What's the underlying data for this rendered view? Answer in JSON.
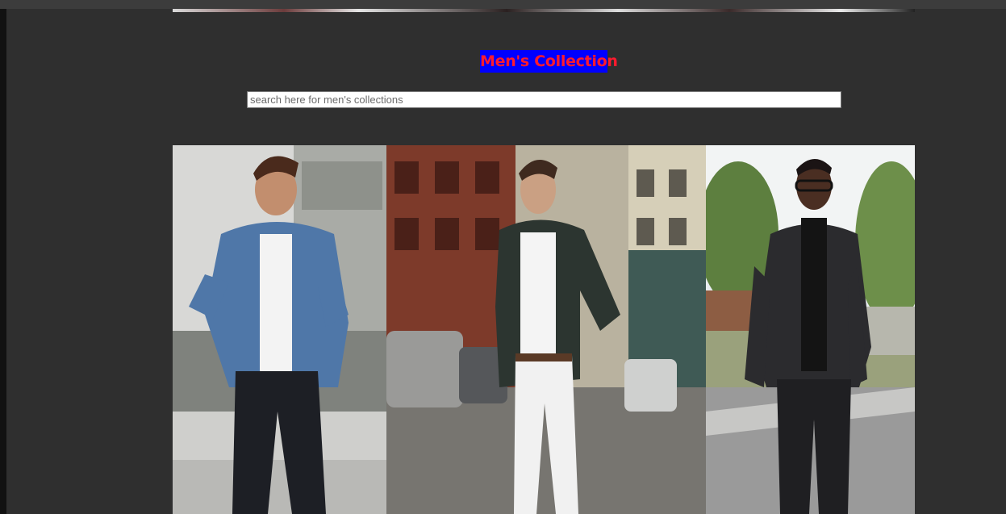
{
  "header": {
    "title": "Men's Collection"
  },
  "search": {
    "placeholder": "search here for men's collections",
    "value": ""
  },
  "gallery": {
    "photos": [
      {
        "subject": "man in denim jacket and black ripped jeans"
      },
      {
        "subject": "man in dark jacket and white jeans on city street"
      },
      {
        "subject": "man in glasses, black turtleneck and black denim jacket"
      }
    ]
  },
  "colors": {
    "page_background": "#2f2f2f",
    "title_background": "#0000ff",
    "title_text": "#ff1a2e"
  }
}
